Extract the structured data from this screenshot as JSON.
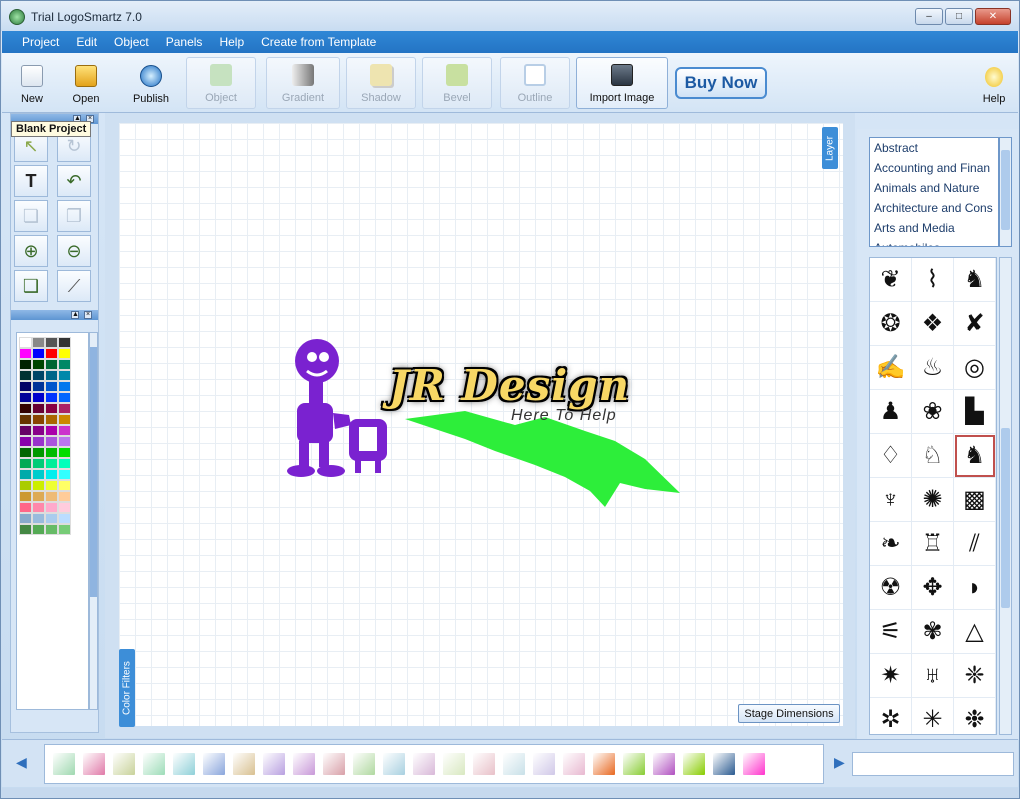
{
  "window": {
    "title": "Trial LogoSmartz 7.0"
  },
  "menu": [
    "Project",
    "Edit",
    "Object",
    "Panels",
    "Help",
    "Create from Template"
  ],
  "toolbar": {
    "new": "New",
    "open": "Open",
    "publish": "Publish",
    "object": "Object",
    "gradient": "Gradient",
    "shadow": "Shadow",
    "bevel": "Bevel",
    "outline": "Outline",
    "import_image": "Import Image",
    "buy_now": "Buy Now",
    "help": "Help"
  },
  "tooltip": "Blank Project",
  "canvas": {
    "layer_tab": "Layer",
    "color_filters_tab": "Color Filters",
    "stage_dimensions": "Stage Dimensions",
    "logo_text": "JR Design",
    "logo_tagline": "Here To Help"
  },
  "categories": [
    "Abstract",
    "Accounting and Finan",
    "Animals and Nature",
    "Architecture and Cons",
    "Arts and Media",
    "Automobiles"
  ],
  "symbols": [
    "❦",
    "⌇",
    "♞",
    "❂",
    "❖",
    "✘",
    "✍",
    "♨",
    "◎",
    "♟",
    "❀",
    "▙",
    "♢",
    "♘",
    "♞",
    "♆",
    "✺",
    "▩",
    "❧",
    "♖",
    "⫽",
    "☢",
    "✥",
    "◗",
    "⚟",
    "✾",
    "△",
    "✷",
    "♅",
    "❈",
    "✲",
    "✳",
    "❉"
  ],
  "palette_colors": [
    "#ffffff",
    "#888888",
    "#555555",
    "#333333",
    "#ff00ff",
    "#0000ff",
    "#ff0000",
    "#ffff00",
    "#002200",
    "#004400",
    "#006633",
    "#008866",
    "#003333",
    "#004466",
    "#006688",
    "#0088aa",
    "#000066",
    "#003399",
    "#0055cc",
    "#0077ee",
    "#000099",
    "#0000cc",
    "#0033ff",
    "#0066ff",
    "#330000",
    "#660033",
    "#880044",
    "#aa2266",
    "#663300",
    "#884400",
    "#aa6600",
    "#cc8800",
    "#660066",
    "#880088",
    "#aa00aa",
    "#cc33cc",
    "#8800aa",
    "#9933cc",
    "#aa55dd",
    "#bb77ee",
    "#006600",
    "#009900",
    "#00bb00",
    "#00dd00",
    "#00aa55",
    "#00cc77",
    "#00ee99",
    "#00ffbb",
    "#00aaaa",
    "#00cccc",
    "#00eeee",
    "#33ffff",
    "#aacc00",
    "#ccee00",
    "#eeff33",
    "#ffff66",
    "#cc9933",
    "#ddaa55",
    "#eebb77",
    "#ffcc99",
    "#ff6688",
    "#ff88aa",
    "#ffaacc",
    "#ffccdd",
    "#88aacc",
    "#99bbdd",
    "#aaccee",
    "#bbddff",
    "#448844",
    "#55aa55",
    "#66bb66",
    "#77cc77"
  ],
  "gradients": [
    "#9fd8b0",
    "#e07aa8",
    "#c8d29a",
    "#9ddcb8",
    "#8fd0d8",
    "#8aa6dc",
    "#d8c090",
    "#b8a0e0",
    "#c898d8",
    "#d8a0a8",
    "#b0d8a0",
    "#a8d0e0",
    "#d8b8d8",
    "#d8e8c0",
    "#e8c0c8",
    "#c8e0e8",
    "#d0c8e8",
    "#e8b8d0",
    "#e86820",
    "#88cc33",
    "#b050c0",
    "#88cc00",
    "#2a5a90",
    "#ff33cc"
  ]
}
